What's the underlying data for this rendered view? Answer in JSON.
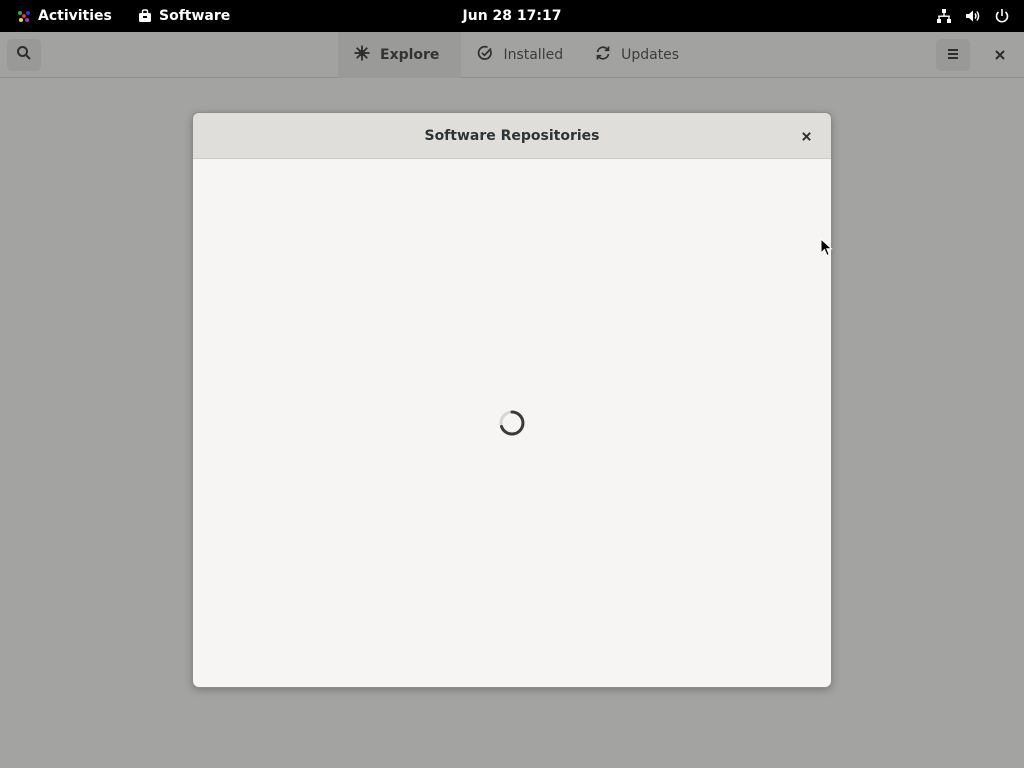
{
  "topbar": {
    "activities_label": "Activities",
    "app_label": "Software",
    "clock": "Jun 28  17:17",
    "status_icons": [
      "network-icon",
      "volume-icon",
      "power-icon"
    ]
  },
  "headerbar": {
    "search_icon": "search-icon",
    "tabs": [
      {
        "label": "Explore",
        "icon": "explore-icon",
        "active": true
      },
      {
        "label": "Installed",
        "icon": "installed-check-icon",
        "active": false
      },
      {
        "label": "Updates",
        "icon": "updates-refresh-icon",
        "active": false
      }
    ],
    "menu_icon": "hamburger-menu-icon",
    "close_icon": "close-icon"
  },
  "dialog": {
    "title": "Software Repositories",
    "loading": true
  },
  "colors": {
    "topbar_bg": "#000000",
    "headerbar_bg": "#a2a2a0",
    "dialog_bg": "#f6f5f4",
    "dialog_header_bg": "#e0dedb"
  }
}
